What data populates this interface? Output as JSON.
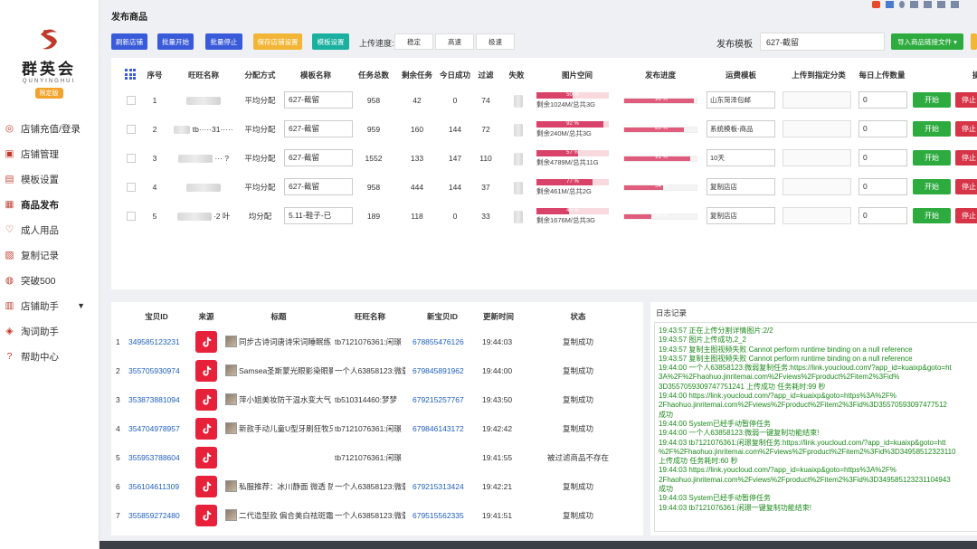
{
  "app": {
    "logo_name": "群英会",
    "logo_sub": "QUNYINGHUI",
    "logo_badge": "限定版"
  },
  "sidebar": {
    "items": [
      {
        "label": "店铺充值/登录",
        "icon": "shop-recharge-icon"
      },
      {
        "label": "店铺管理",
        "icon": "store-icon"
      },
      {
        "label": "模板设置",
        "icon": "template-icon"
      },
      {
        "label": "商品发布",
        "icon": "publish-icon"
      },
      {
        "label": "成人用品",
        "icon": "adult-products-icon"
      },
      {
        "label": "复制记录",
        "icon": "copy-record-icon"
      },
      {
        "label": "突破500",
        "icon": "breakthrough-icon"
      },
      {
        "label": "店铺助手",
        "icon": "assistant-icon"
      },
      {
        "label": "淘词助手",
        "icon": "keyword-icon"
      },
      {
        "label": "帮助中心",
        "icon": "help-icon"
      }
    ],
    "active_index": 3
  },
  "header": {
    "title": "发布商品"
  },
  "toolbar": {
    "buttons": [
      "刷新店铺",
      "批量开始",
      "批量停止",
      "保存店铺设置",
      "模板设置"
    ],
    "speed_label": "上传速度:",
    "speed_options": [
      "稳定",
      "高速",
      "极速"
    ],
    "template_label": "发布模板",
    "template_value": "627-截留",
    "import_button": "导入商品链接文件 ▾"
  },
  "shops_table": {
    "columns": [
      "序号",
      "旺旺名称",
      "分配方式",
      "模板名称",
      "任务总数",
      "剩余任务",
      "今日成功",
      "过滤",
      "失败",
      "图片空间",
      "发布进度",
      "运费模板",
      "上传到指定分类",
      "每日上传数量",
      "操"
    ],
    "rows": [
      {
        "no": "1",
        "wangwang": "",
        "alloc": "平均分配",
        "tpl": "627-截留",
        "total": "958",
        "remain": "42",
        "today": "0",
        "filter": "74",
        "img_pct": 50,
        "img_label": "50 %",
        "img_text": "剩余1024M/总共3G",
        "prog_pct": 96,
        "prog_label": "96 %",
        "freight": "山东菏泽包邮",
        "daily": "0",
        "start": "开始",
        "stop": "停止"
      },
      {
        "no": "2",
        "wangwang": "tb·····31·····",
        "alloc": "平均分配",
        "tpl": "627-截留",
        "total": "959",
        "remain": "160",
        "today": "144",
        "filter": "72",
        "img_pct": 92,
        "img_label": "92 %",
        "img_text": "剩余240M/总共3G",
        "prog_pct": 83,
        "prog_label": "83 %",
        "freight": "系统模板-商品",
        "daily": "0",
        "start": "开始",
        "stop": "停止"
      },
      {
        "no": "3",
        "wangwang": "··· ?",
        "alloc": "平均分配",
        "tpl": "627-截留",
        "total": "1552",
        "remain": "133",
        "today": "147",
        "filter": "110",
        "img_pct": 57,
        "img_label": "57 %",
        "img_text": "剩余4789M/总共11G",
        "prog_pct": 91,
        "prog_label": "91 %",
        "freight": "10天",
        "daily": "0",
        "start": "开始",
        "stop": "停止"
      },
      {
        "no": "4",
        "wangwang": "",
        "alloc": "平均分配",
        "tpl": "627-截留",
        "total": "958",
        "remain": "444",
        "today": "144",
        "filter": "37",
        "img_pct": 77,
        "img_label": "77 %",
        "img_text": "剩余461M/总共2G",
        "prog_pct": 54,
        "prog_label": "54 %",
        "freight": "复制店店",
        "daily": "0",
        "start": "开始",
        "stop": "停止"
      },
      {
        "no": "5",
        "wangwang": "·2 叶",
        "alloc": "均分配",
        "tpl": "5.11-鞋子-已",
        "total": "189",
        "remain": "118",
        "today": "0",
        "filter": "33",
        "img_pct": 45,
        "img_label": "45 %",
        "img_text": "剩余1676M/总共3G",
        "prog_pct": 38,
        "prog_label": "38 %",
        "freight": "复制店店",
        "daily": "0",
        "start": "开始",
        "stop": "停止"
      }
    ]
  },
  "items_table": {
    "columns": [
      "宝贝ID",
      "来源",
      "标题",
      "旺旺名称",
      "新宝贝ID",
      "更新时间",
      "状态"
    ],
    "rows": [
      {
        "no": "1",
        "id": "349585123231",
        "source": "tiktok-icon",
        "title": "同步古诗词唐诗宋词睡眠练",
        "wangwang": "tb7121076361:闲璟",
        "new_id": "678855476126",
        "time": "19:44:03",
        "status": "复制成功"
      },
      {
        "no": "2",
        "id": "355705930974",
        "source": "tiktok-icon",
        "title": "Samsea圣斯蒙光眼影染眼影",
        "wangwang": "一个人63858123:微弱",
        "new_id": "679845891962",
        "time": "19:44:00",
        "status": "复制成功"
      },
      {
        "no": "3",
        "id": "353873881094",
        "source": "tiktok-icon",
        "title": "萍小姐美妆防干温水变大气",
        "wangwang": "tb510314460:梦梦",
        "new_id": "679215257767",
        "time": "19:43:50",
        "status": "复制成功"
      },
      {
        "no": "4",
        "id": "354704978957",
        "source": "tiktok-icon",
        "title": "新款手动儿童U型牙刷狂牧牙",
        "wangwang": "tb7121076361:闲璟",
        "new_id": "679846143172",
        "time": "19:42:42",
        "status": "复制成功"
      },
      {
        "no": "5",
        "id": "355953788604",
        "source": "tiktok-icon",
        "title": "",
        "wangwang": "tb7121076361:闲璟",
        "new_id": "",
        "time": "19:41:55",
        "status": "被过滤商品不存在"
      },
      {
        "no": "6",
        "id": "356104611309",
        "source": "tiktok-icon",
        "title": "私服推荐：冰川静面 微透 防",
        "wangwang": "一个人63858123:微弱",
        "new_id": "679215313424",
        "time": "19:42:21",
        "status": "复制成功"
      },
      {
        "no": "7",
        "id": "355859272480",
        "source": "tiktok-icon",
        "title": "二代造型款 偏合美白祛斑霜",
        "wangwang": "一个人63858123:微弱",
        "new_id": "679515562335",
        "time": "19:41:51",
        "status": "复制成功"
      }
    ]
  },
  "log": {
    "title": "日志记录",
    "lines": [
      "19:43:57 正在上传分割详情图片:2/2",
      "19:43:57 图片上传成功,2_2",
      "19:43:57 复制主图视频失败 Cannot perform runtime binding on a null reference",
      "19:43:57 复制主图视频失败 Cannot perform runtime binding on a null reference",
      "19:44:00 一个人63858123:微弱复制任务:https://link.youcloud.com/?app_id=kuaixp&goto=ht",
      "3A%2F%2Fhaohuo.jinritemai.com%2Fviews%2Fproduct%2Fitem2%3Fid%",
      "3D3557059309747751241 上传成功 任务耗时:99 秒",
      "19:44:00 https://link.youcloud.com/?app_id=kuaixp&goto=https%3A%2F%",
      "2Fhaohuo.jinritemai.com%2Fviews%2Fproduct%2Fitem2%3Fid%3D35570593097477512",
      "成功",
      "19:44:00 System已经手动暂停任务",
      "19:44:00 一个人63858123:微弱一键复制功能结束!",
      "19:44:03 tb7121076361:闲璟复制任务:https://link.youcloud.com/?app_id=kuaixp&goto=htt",
      "%2F%2Fhaohuo.jinritemai.com%2Fviews%2Fproduct%2Fitem2%3Fid%3D34958512323110",
      "上传成功 任务耗时:60 秒",
      "19:44:03 https://link.youcloud.com/?app_id=kuaixp&goto=https%3A%2F%",
      "2Fhaohuo.jinritemai.com%2Fviews%2Fproduct%2Fitem2%3Fid%3D349585123231104943",
      "成功",
      "19:44:03 System已经手动暂停任务",
      "19:44:03 tb7121076361:闲璟一键复制功能结束!"
    ]
  },
  "colors": {
    "primary_btn": "#3a5bd9",
    "orange_btn": "#f2b535",
    "teal_btn": "#1aaf9f",
    "green_btn": "#2dab3f",
    "red_btn": "#d63447",
    "import_btn": "#2dab3f"
  }
}
